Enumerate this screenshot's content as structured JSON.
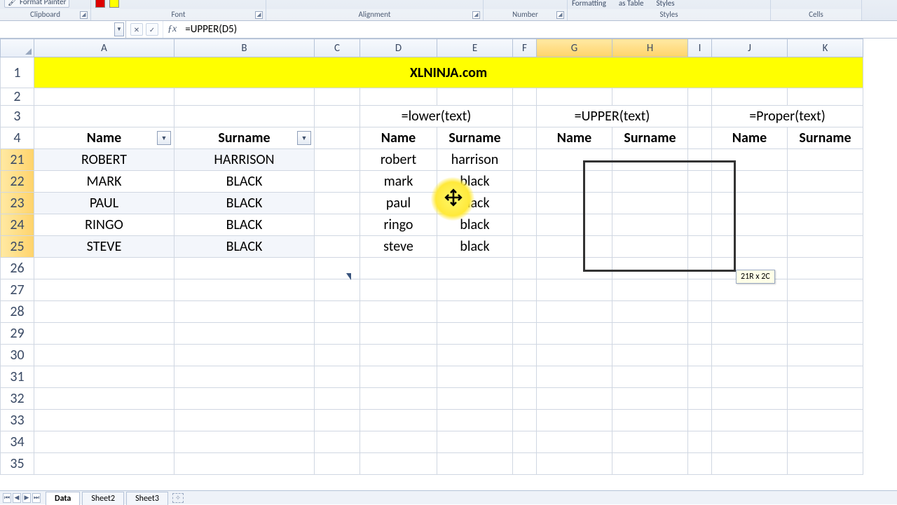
{
  "ribbon": {
    "format_painter": "Format Painter",
    "groups": {
      "clipboard": "Clipboard",
      "font": "Font",
      "alignment": "Alignment",
      "number": "Number",
      "styles": "Styles",
      "cells": "Cells"
    },
    "styles_items": {
      "formatting": "Formatting",
      "as_table": "as Table",
      "styles": "Styles"
    }
  },
  "namebox": "",
  "formula": "=UPPER(D5)",
  "columns": [
    "A",
    "B",
    "C",
    "D",
    "E",
    "F",
    "G",
    "H",
    "I",
    "J",
    "K"
  ],
  "selected_columns": [
    "G",
    "H"
  ],
  "row_labels": [
    "1",
    "2",
    "3",
    "4",
    "21",
    "22",
    "23",
    "24",
    "25",
    "26",
    "27",
    "28",
    "29",
    "30",
    "31",
    "32",
    "33",
    "34",
    "35"
  ],
  "selected_rows": [
    "21",
    "22",
    "23",
    "24",
    "25"
  ],
  "banner": "XLNINJA.com",
  "row3": {
    "lower": "=lower(text)",
    "upper": "=UPPER(text)",
    "proper": "=Proper(text)"
  },
  "headers": {
    "name": "Name",
    "surname": "Surname"
  },
  "data_rows": [
    {
      "name": "ROBERT",
      "surname": "HARRISON",
      "lname": "robert",
      "lsur": "harrison"
    },
    {
      "name": "MARK",
      "surname": "BLACK",
      "lname": "mark",
      "lsur": "black"
    },
    {
      "name": "PAUL",
      "surname": "BLACK",
      "lname": "paul",
      "lsur": "black"
    },
    {
      "name": "RINGO",
      "surname": "BLACK",
      "lname": "ringo",
      "lsur": "black"
    },
    {
      "name": "STEVE",
      "surname": "BLACK",
      "lname": "steve",
      "lsur": "black"
    }
  ],
  "size_tip": "21R x 2C",
  "tabs": {
    "t1": "Data",
    "t2": "Sheet2",
    "t3": "Sheet3"
  }
}
